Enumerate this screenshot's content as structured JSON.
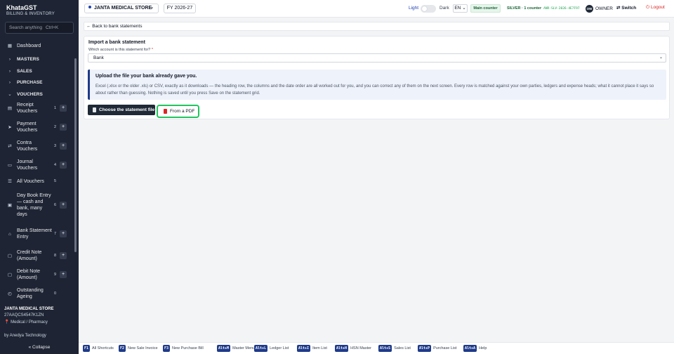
{
  "app": {
    "name": "KhataGST",
    "subtitle": "BILLING & INVENTORY"
  },
  "search": {
    "placeholder": "Search anything",
    "shortcut": "Ctrl+K"
  },
  "nav": [
    {
      "label": "Dashboard",
      "icon": "grid-icon",
      "section": false,
      "num": "",
      "plus": false
    },
    {
      "label": "MASTERS",
      "icon": "chevron-right-icon",
      "section": true,
      "num": "",
      "plus": false
    },
    {
      "label": "SALES",
      "icon": "chevron-right-icon",
      "section": true,
      "num": "",
      "plus": false
    },
    {
      "label": "PURCHASE",
      "icon": "chevron-right-icon",
      "section": true,
      "num": "",
      "plus": false
    },
    {
      "label": "VOUCHERS",
      "icon": "chevron-down-icon",
      "section": true,
      "num": "",
      "plus": false
    },
    {
      "label": "Receipt Vouchers",
      "icon": "receipt-icon",
      "section": false,
      "num": "1",
      "plus": true
    },
    {
      "label": "Payment Vouchers",
      "icon": "send-icon",
      "section": false,
      "num": "2",
      "plus": true
    },
    {
      "label": "Contra Vouchers",
      "icon": "swap-icon",
      "section": false,
      "num": "3",
      "plus": true
    },
    {
      "label": "Journal Vouchers",
      "icon": "book-icon",
      "section": false,
      "num": "4",
      "plus": true
    },
    {
      "label": "All Vouchers",
      "icon": "list-icon",
      "section": false,
      "num": "5",
      "plus": false
    },
    {
      "label": "Day Book Entry — cash and bank, many days",
      "icon": "daybook-icon",
      "section": false,
      "num": "6",
      "plus": true
    },
    {
      "label": "Bank Statement Entry",
      "icon": "bank-icon",
      "section": false,
      "num": "7",
      "plus": true
    },
    {
      "label": "Credit Note (Amount)",
      "icon": "note-icon",
      "section": false,
      "num": "8",
      "plus": true
    },
    {
      "label": "Debit Note (Amount)",
      "icon": "note-icon",
      "section": false,
      "num": "9",
      "plus": true
    },
    {
      "label": "Outstanding Ageing",
      "icon": "clock-icon",
      "section": false,
      "num": "0",
      "plus": false
    }
  ],
  "company": {
    "name": "JANTA MEDICAL STORE",
    "gstin": "27AAQCS4547K1ZN",
    "type": "Medical / Pharmacy"
  },
  "footer": {
    "by": "by Anedya Technology",
    "collapse": "« Collapse"
  },
  "topbar": {
    "store": "JANTA MEDICAL STORE",
    "fy": "FY 2026-27",
    "theme_light": "Light",
    "theme_dark": "Dark",
    "lang": "EN",
    "counter": "Main counter",
    "plan": "SILVER · 1 counter",
    "license": "ANR-SLV-2026-4E7F97",
    "avatar": "OW",
    "role": "OWNER",
    "switch": "Switch",
    "logout": "Logout"
  },
  "page": {
    "back": "← Back to bank statements",
    "title": "Import a bank statement",
    "account_label": "Which account is this statement for?",
    "account_required": "*",
    "account_value": "Bank",
    "info_title": "Upload the file your bank already gave you.",
    "info_body": "Excel (.xlsx or the older .xls) or CSV, exactly as it downloads — the heading row, the columns and the date order are all worked out for you, and you can correct any of them on the next screen. Every row is matched against your own parties, ledgers and expense heads; what it cannot place it says so about rather than guessing. Nothing is saved until you press Save on the statement grid.",
    "choose_btn": "Choose the statement file",
    "pdf_btn": "From a PDF"
  },
  "shortcuts": [
    {
      "key": "F1",
      "label": "All Shortcuts"
    },
    {
      "key": "F2",
      "label": "New Sale Invoice"
    },
    {
      "key": "F3",
      "label": "New Purchase Bill"
    },
    {
      "key": "Alt+M",
      "label": "Master Menu"
    },
    {
      "key": "Alt+L",
      "label": "Ledger List"
    },
    {
      "key": "Alt+I",
      "label": "Item List"
    },
    {
      "key": "Alt+H",
      "label": "HSN Master"
    },
    {
      "key": "Alt+S",
      "label": "Sales List"
    },
    {
      "key": "Alt+P",
      "label": "Purchase List"
    },
    {
      "key": "Alt+A",
      "label": "Help"
    }
  ],
  "colors": {
    "sidebar": "#1e2433",
    "accent": "#1e3a8a",
    "highlight": "#22c55e",
    "danger": "#dc2626"
  }
}
